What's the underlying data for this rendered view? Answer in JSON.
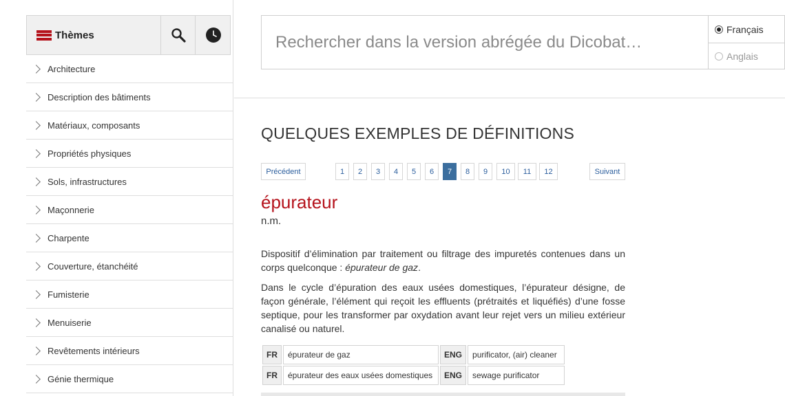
{
  "sidebar": {
    "themes_label": "Thèmes",
    "search_icon": "magnifier-icon",
    "history_icon": "clock-icon",
    "items": [
      {
        "label": "Architecture"
      },
      {
        "label": "Description des bâtiments"
      },
      {
        "label": "Matériaux, composants"
      },
      {
        "label": "Propriétés physiques"
      },
      {
        "label": "Sols, infrastructures"
      },
      {
        "label": "Maçonnerie"
      },
      {
        "label": "Charpente"
      },
      {
        "label": "Couverture, étanchéité"
      },
      {
        "label": "Fumisterie"
      },
      {
        "label": "Menuiserie"
      },
      {
        "label": "Revêtements intérieurs"
      },
      {
        "label": "Génie thermique"
      }
    ]
  },
  "search": {
    "placeholder": "Rechercher dans la version abrégée du Dicobat…",
    "languages": [
      {
        "label": "Français",
        "selected": true
      },
      {
        "label": "Anglais",
        "selected": false
      }
    ]
  },
  "main": {
    "title": "QUELQUES EXEMPLES DE DÉFINITIONS",
    "pager": {
      "prev": "Précédent",
      "next": "Suivant",
      "pages": [
        "1",
        "2",
        "3",
        "4",
        "5",
        "6",
        "7",
        "8",
        "9",
        "10",
        "11",
        "12"
      ],
      "current": "7"
    },
    "entry": {
      "term": "épurateur",
      "grammar": "n.m.",
      "para1_text": "Dispositif d’élimination par traitement ou filtrage des impuretés contenues dans un corps quelconque : ",
      "para1_example": "épurateur de gaz",
      "para1_end": ".",
      "para2": "Dans le cycle d’épuration des eaux usées domestiques, l’épurateur désigne, de façon générale, l’élément qui reçoit les effluents (prétraités et liquéfiés) d’une fosse septique, pour les transformer par oxydation avant leur rejet vers un milieu extérieur canalisé ou naturel.",
      "translations": [
        {
          "fr_code": "FR",
          "fr": "épurateur de gaz",
          "en_code": "ENG",
          "en": "purificator, (air) cleaner"
        },
        {
          "fr_code": "FR",
          "fr": "épurateur des eaux usées domestiques",
          "en_code": "ENG",
          "en": "sewage purificator"
        }
      ]
    }
  },
  "colors": {
    "accent_red": "#b5121b",
    "pager_active": "#3b6e9e",
    "link_blue": "#2a5d9c"
  }
}
